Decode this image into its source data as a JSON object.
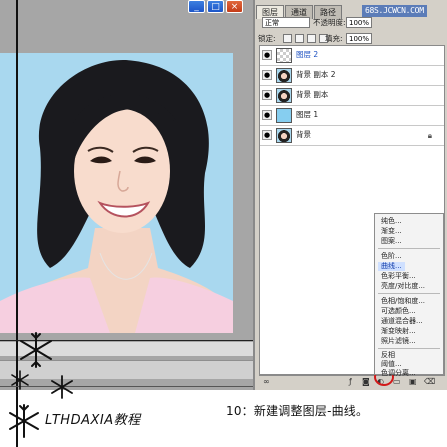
{
  "window": {
    "minimize": "_",
    "maximize": "□",
    "close": "×"
  },
  "panel": {
    "tabs": [
      "图层",
      "通道",
      "路径"
    ],
    "active_tab": 0,
    "watermark": "68S.JCWCN.COM",
    "blend_mode": "正常",
    "opacity_label": "不透明度:",
    "opacity_value": "100%",
    "lock_label": "锁定:",
    "fill_label": "填充:",
    "fill_value": "100%",
    "layers": [
      {
        "name": "图层 2",
        "selected": true
      },
      {
        "name": "背景 副本 2",
        "selected": false
      },
      {
        "name": "背景 副本",
        "selected": false
      },
      {
        "name": "图层 1",
        "selected": false
      },
      {
        "name": "背景",
        "selected": false,
        "locked": true
      }
    ]
  },
  "adjustment_menu": {
    "items": [
      "纯色...",
      "渐变...",
      "图案...",
      "色阶...",
      "曲线...",
      "色彩平衡...",
      "亮度/对比度...",
      "色相/饱和度...",
      "可选颜色...",
      "通道混合器...",
      "渐变映射...",
      "照片滤镜...",
      "反相",
      "阈值...",
      "色调分离..."
    ],
    "highlighted": "曲线..."
  },
  "colors": {
    "photo_bg": "#a9d8ef",
    "panel_bg": "#d4d0c8",
    "highlight_circle": "#d21a1a",
    "selected_layer_text": "#1b4fc0"
  },
  "caption": {
    "brand": "LTHDAXIA教程",
    "step": "10：新建调整图层-曲线。"
  }
}
